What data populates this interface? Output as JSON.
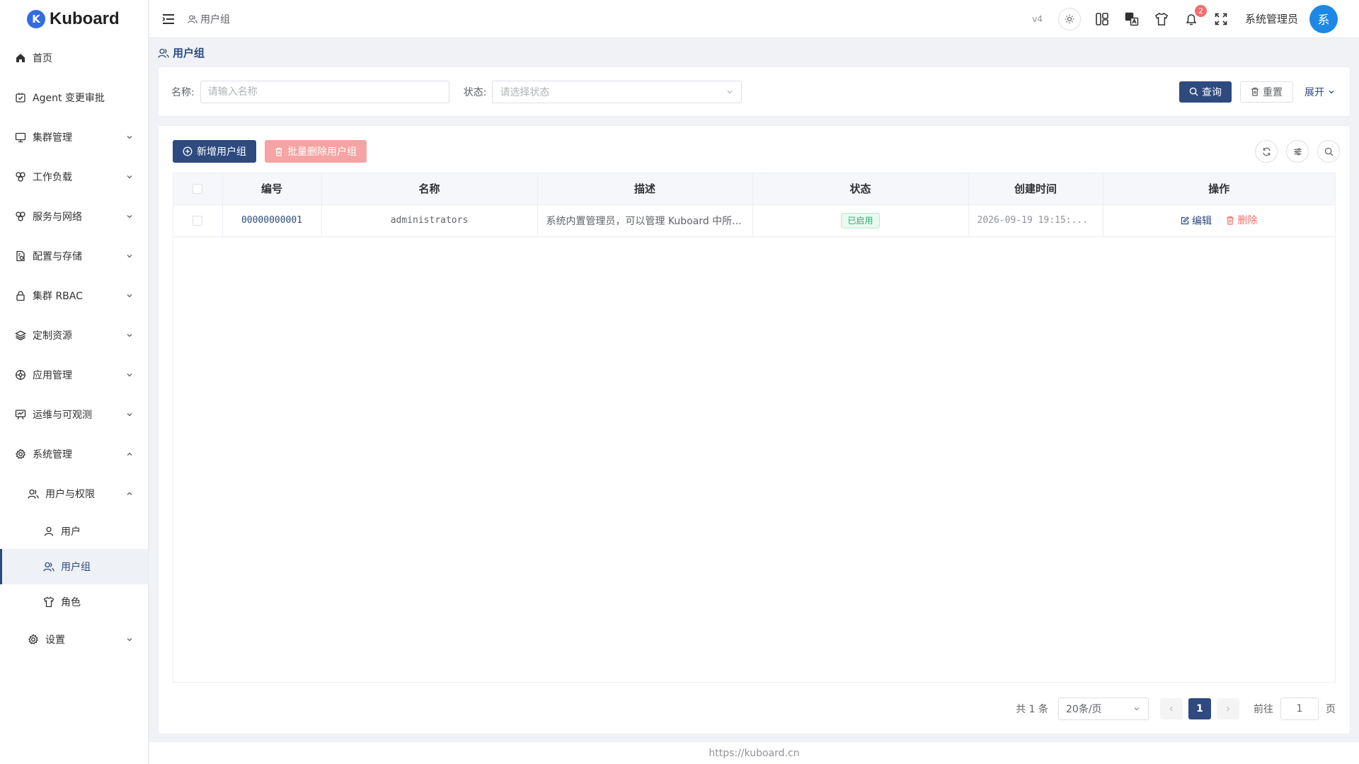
{
  "app": {
    "logo_letter": "K",
    "name": "Kuboard"
  },
  "sidebar": {
    "items": [
      {
        "label": "首页",
        "icon": "home-icon"
      },
      {
        "label": "Agent 变更审批",
        "icon": "approve-icon"
      },
      {
        "label": "集群管理",
        "icon": "monitor-icon"
      },
      {
        "label": "工作负载",
        "icon": "workload-icon"
      },
      {
        "label": "服务与网络",
        "icon": "network-icon"
      },
      {
        "label": "配置与存储",
        "icon": "config-icon"
      },
      {
        "label": "集群 RBAC",
        "icon": "lock-icon"
      },
      {
        "label": "定制资源",
        "icon": "layers-icon"
      },
      {
        "label": "应用管理",
        "icon": "app-icon"
      },
      {
        "label": "运维与可观测",
        "icon": "observe-icon"
      },
      {
        "label": "系统管理",
        "icon": "gear-icon"
      }
    ],
    "sub": {
      "label": "用户与权限"
    },
    "leaves": [
      {
        "label": "用户"
      },
      {
        "label": "用户组"
      },
      {
        "label": "角色"
      }
    ],
    "settings": {
      "label": "设置"
    }
  },
  "header": {
    "breadcrumb": "用户组",
    "version": "v4",
    "notification_count": "2",
    "username": "系统管理员",
    "avatar_char": "系"
  },
  "page": {
    "title": "用户组"
  },
  "search": {
    "name_label": "名称:",
    "name_placeholder": "请输入名称",
    "status_label": "状态:",
    "status_placeholder": "请选择状态",
    "query_label": "查询",
    "reset_label": "重置",
    "expand_label": "展开"
  },
  "toolbar": {
    "add_label": "新增用户组",
    "batch_delete_label": "批量删除用户组"
  },
  "table": {
    "columns": [
      "编号",
      "名称",
      "描述",
      "状态",
      "创建时间",
      "操作"
    ],
    "rows": [
      {
        "id": "00000000001",
        "name": "administrators",
        "desc": "系统内置管理员，可以管理 Kuboard 中所...",
        "status": "已启用",
        "created": "2026-09-19 19:15:...",
        "edit": "编辑",
        "delete": "删除"
      }
    ]
  },
  "pagination": {
    "total_text": "共 1 条",
    "page_size": "20条/页",
    "current_page": "1",
    "goto_label": "前往",
    "goto_value": "1",
    "page_unit": "页"
  },
  "footer": {
    "url": "https://kuboard.cn"
  },
  "colors": {
    "primary": "#2e4a7f",
    "danger": "#f56c6c",
    "success": "#1db36b",
    "avatar": "#1e88e5"
  }
}
